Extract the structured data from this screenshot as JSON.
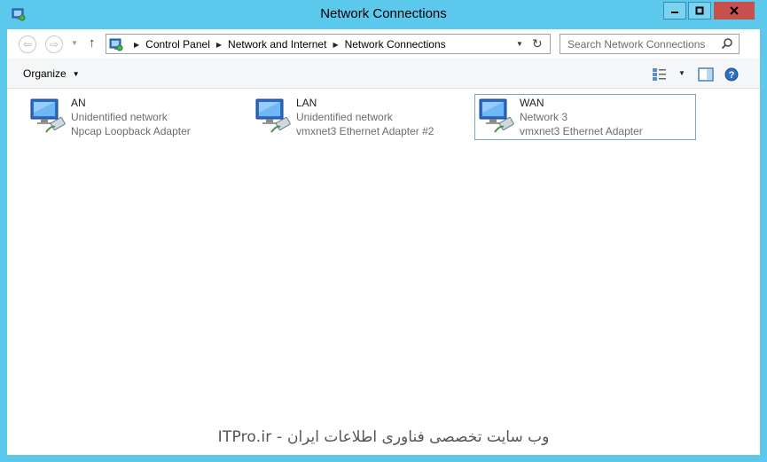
{
  "window": {
    "title": "Network Connections",
    "controls": {
      "minimize": "▬",
      "maximize": "□",
      "close": "✕"
    },
    "accent": "#5bc8ec",
    "close_color": "#c7504c"
  },
  "navigation": {
    "back_icon": "back-arrow-icon",
    "forward_icon": "forward-arrow-icon",
    "up_icon": "up-arrow-icon",
    "breadcrumb": [
      "Control Panel",
      "Network and Internet",
      "Network Connections"
    ],
    "refresh_icon": "refresh-icon"
  },
  "search": {
    "placeholder": "Search Network Connections"
  },
  "toolbar": {
    "organize_label": "Organize"
  },
  "connections": [
    {
      "name": "AN",
      "network": "Unidentified network",
      "adapter": "Npcap Loopback Adapter",
      "selected": false
    },
    {
      "name": "LAN",
      "network": "Unidentified network",
      "adapter": "vmxnet3 Ethernet Adapter #2",
      "selected": false
    },
    {
      "name": "WAN",
      "network": "Network  3",
      "adapter": "vmxnet3 Ethernet Adapter",
      "selected": true
    }
  ],
  "watermark": "ITPro.ir - وب سایت تخصصی فناوری اطلاعات ایران"
}
